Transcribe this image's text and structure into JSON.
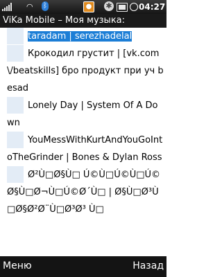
{
  "status": {
    "time": "04:27"
  },
  "title": "ViKa Mobile – Моя музыка:",
  "tracks": [
    {
      "text": "taradam | serezhadelal"
    },
    {
      "text": "Крокодил грустит | [vk.com\\/beatskills] бро продукт при уч besad"
    },
    {
      "text": "Lonely Day | System Of A Down"
    },
    {
      "text": "YouMessWithKurtAndYouGoIntoTheGrinder | Bones & Dylan Ross"
    },
    {
      "text": "Ø²Ù□Ø§Ù□ Ú©Ù□Ú©Ù□Ú© Ø§Ù□Ø¬Ù□Ú©Ø´Ù□ | Ø§Ù□Ø³Ù□Ø§Ø²Ø¨Ù□Ø³Ø³ Ù□"
    }
  ],
  "softkeys": {
    "left": "Меню",
    "right": "Назад"
  }
}
